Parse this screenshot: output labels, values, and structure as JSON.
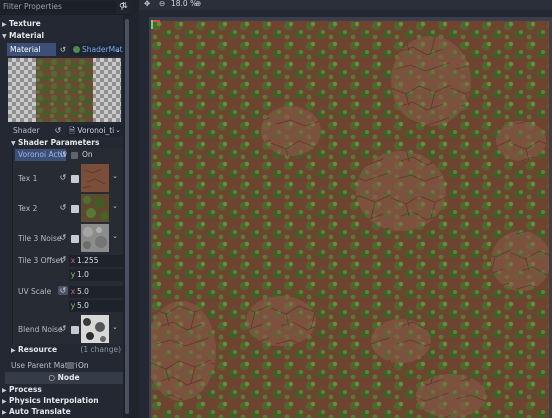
{
  "inspector": {
    "filter_placeholder": "Filter Properties",
    "sections_top": [
      {
        "label": "Texture"
      },
      {
        "label": "Material"
      }
    ],
    "material": {
      "label": "Material",
      "resource": "ShaderMat",
      "shader_label": "Shader",
      "shader_resource": "Voronoi_ti",
      "shader_params_label": "Shader Parameters",
      "params": {
        "voronoi_label": "Voronoi Activ",
        "voronoi_value": "On",
        "tex1_label": "Tex 1",
        "tex2_label": "Tex 2",
        "tile3_label": "Tile 3 Noise",
        "tile3_offset_label": "Tile 3 Offset",
        "tile3_offset_x": "1.255",
        "tile3_offset_y": "1.0",
        "uv_scale_label": "UV Scale",
        "uv_scale_x": "5.0",
        "uv_scale_y": "5.0",
        "blend_noise_label": "Blend Noise"
      },
      "resource_label": "Resource",
      "resource_changes": "(1 change)"
    },
    "use_parent_label": "Use Parent Materi",
    "use_parent_value": "On",
    "node_header": "Node",
    "sections_bottom": [
      {
        "label": "Process"
      },
      {
        "label": "Physics Interpolation"
      },
      {
        "label": "Auto Translate"
      }
    ]
  },
  "viewport": {
    "zoom": "18.0 %"
  },
  "colors": {
    "accent_selected": "#3b4f77",
    "resource_link": "#7aa6f0",
    "soil": "#6e4430",
    "moss": "#3f6b2a"
  }
}
